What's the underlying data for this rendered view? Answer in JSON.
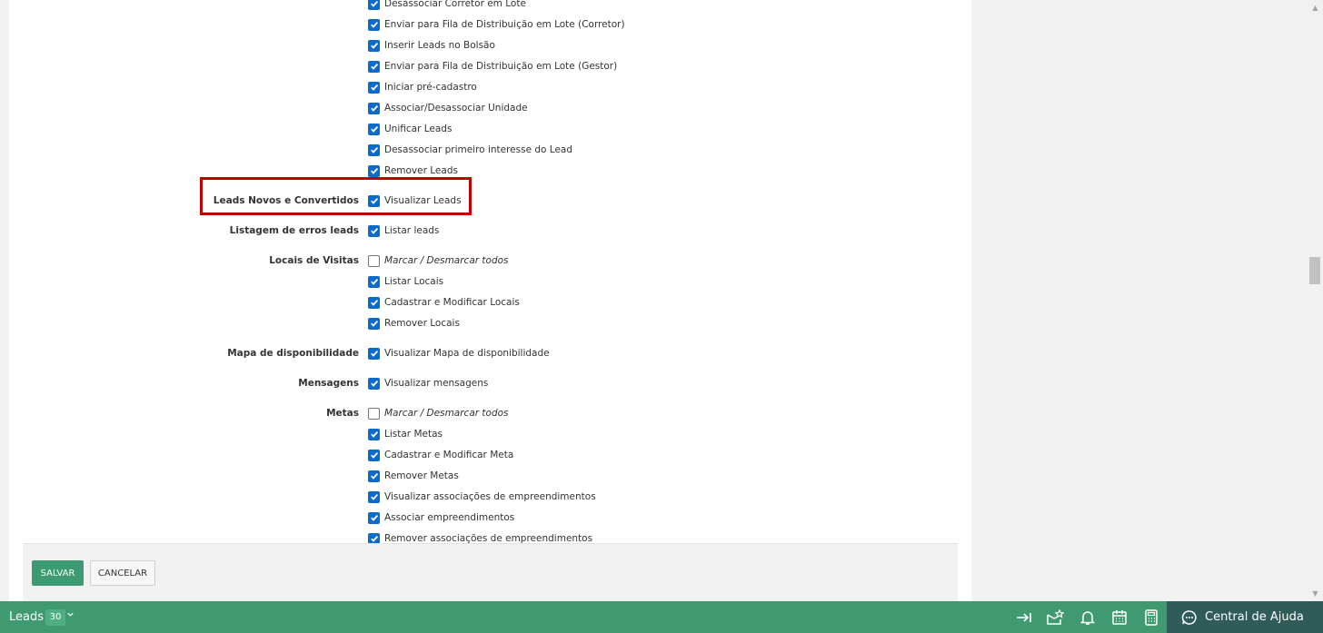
{
  "groups": [
    {
      "label": "",
      "items": [
        {
          "text": "Desassociar Corretor em Lote",
          "checked": true,
          "italic": false
        },
        {
          "text": "Enviar para Fila de Distribuição em Lote (Corretor)",
          "checked": true,
          "italic": false
        },
        {
          "text": "Inserir Leads no Bolsão",
          "checked": true,
          "italic": false
        },
        {
          "text": "Enviar para Fila de Distribuição em Lote (Gestor)",
          "checked": true,
          "italic": false
        },
        {
          "text": "Iniciar pré-cadastro",
          "checked": true,
          "italic": false
        },
        {
          "text": "Associar/Desassociar Unidade",
          "checked": true,
          "italic": false
        },
        {
          "text": "Unificar Leads",
          "checked": true,
          "italic": false
        },
        {
          "text": "Desassociar primeiro interesse do Lead",
          "checked": true,
          "italic": false
        },
        {
          "text": "Remover Leads",
          "checked": true,
          "italic": false
        }
      ]
    },
    {
      "label": "Leads Novos e Convertidos",
      "items": [
        {
          "text": "Visualizar Leads",
          "checked": true,
          "italic": false
        }
      ]
    },
    {
      "label": "Listagem de erros leads",
      "items": [
        {
          "text": "Listar leads",
          "checked": true,
          "italic": false
        }
      ]
    },
    {
      "label": "Locais de Visitas",
      "items": [
        {
          "text": "Marcar / Desmarcar todos",
          "checked": false,
          "italic": true
        },
        {
          "text": "Listar Locais",
          "checked": true,
          "italic": false
        },
        {
          "text": "Cadastrar e Modificar Locais",
          "checked": true,
          "italic": false
        },
        {
          "text": "Remover Locais",
          "checked": true,
          "italic": false
        }
      ]
    },
    {
      "label": "Mapa de disponibilidade",
      "items": [
        {
          "text": "Visualizar Mapa de disponibilidade",
          "checked": true,
          "italic": false
        }
      ]
    },
    {
      "label": "Mensagens",
      "items": [
        {
          "text": "Visualizar mensagens",
          "checked": true,
          "italic": false
        }
      ]
    },
    {
      "label": "Metas",
      "items": [
        {
          "text": "Marcar / Desmarcar todos",
          "checked": false,
          "italic": true
        },
        {
          "text": "Listar Metas",
          "checked": true,
          "italic": false
        },
        {
          "text": "Cadastrar e Modificar Meta",
          "checked": true,
          "italic": false
        },
        {
          "text": "Remover Metas",
          "checked": true,
          "italic": false
        },
        {
          "text": "Visualizar associações de empreendimentos",
          "checked": true,
          "italic": false
        },
        {
          "text": "Associar empreendimentos",
          "checked": true,
          "italic": false
        },
        {
          "text": "Remover associações de empreendimentos",
          "checked": true,
          "italic": false
        }
      ]
    }
  ],
  "footer": {
    "save_label": "SALVAR",
    "cancel_label": "CANCELAR"
  },
  "bottom_bar": {
    "title": "Leads",
    "count": "30",
    "help_label": "Central de Ajuda",
    "icons": [
      "collapse-arrow-icon",
      "star-envelope-icon",
      "bell-icon",
      "calendar-icon",
      "calculator-icon"
    ]
  },
  "colors": {
    "accent": "#3f9a72",
    "checkbox": "#0b6bcc",
    "highlight": "#c00000",
    "help_bg": "#2f5b59"
  }
}
